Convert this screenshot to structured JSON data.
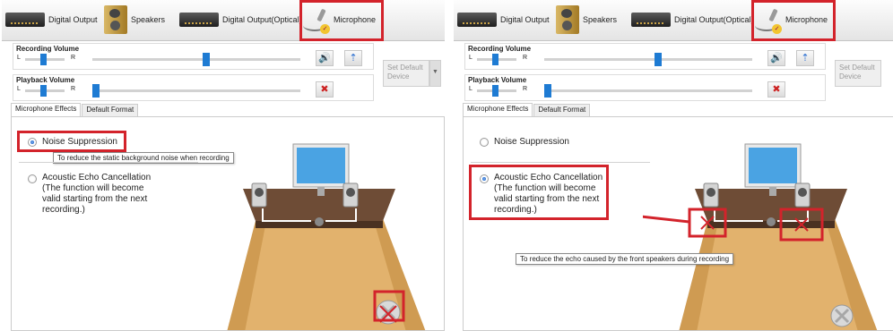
{
  "tabs": {
    "digital_output": "Digital Output",
    "speakers": "Speakers",
    "digital_output_optical": "Digital Output(Optical)",
    "microphone": "Microphone"
  },
  "recording_volume": {
    "title": "Recording Volume",
    "left": "L",
    "right": "R",
    "level": 0.55
  },
  "playback_volume": {
    "title": "Playback Volume",
    "left": "L",
    "right": "R",
    "level": 0.0
  },
  "set_default_device": "Set Default Device",
  "subtabs": [
    "Microphone Effects",
    "Default Format"
  ],
  "effects": {
    "noise_suppression": "Noise Suppression",
    "aec_lines": [
      "Acoustic Echo Cancellation",
      "(The function will become",
      "valid starting from the next",
      "recording.)"
    ]
  },
  "left_panel": {
    "selected": "noise_suppression",
    "tooltip": "To reduce the static background noise when recording"
  },
  "right_panel": {
    "selected": "acoustic_echo_cancellation",
    "tooltip": "To reduce the echo caused by the front speakers during recording"
  },
  "icons": [
    "speaker-volume-icon",
    "microphone-boost-icon",
    "mute-icon",
    "sound-card-icon",
    "speakers-icon",
    "microphone-icon",
    "no-signal-icon"
  ],
  "colors": {
    "highlight": "#d3232b",
    "slider_thumb": "#1e7bd3",
    "table_top": "#6e4c36",
    "floor": "#cf9b52"
  }
}
